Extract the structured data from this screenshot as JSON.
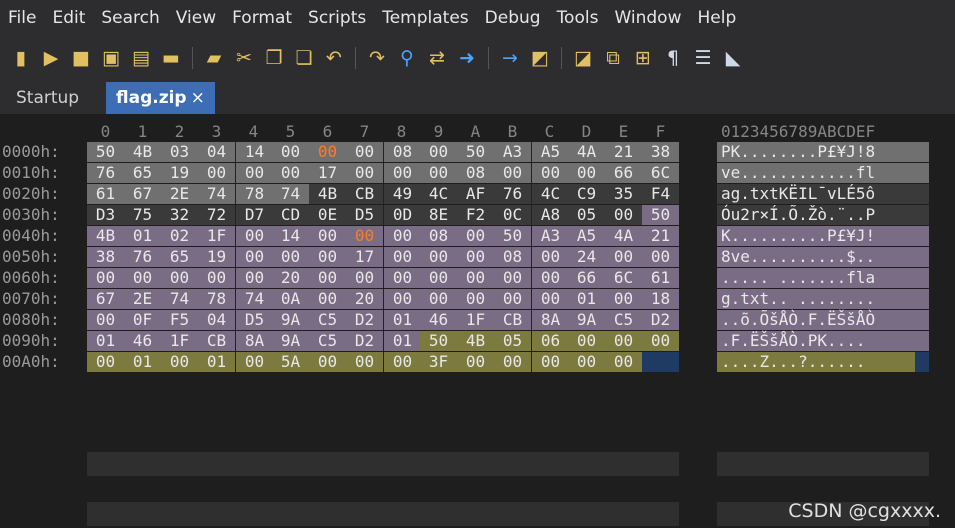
{
  "menu": [
    "File",
    "Edit",
    "Search",
    "View",
    "Format",
    "Scripts",
    "Templates",
    "Debug",
    "Tools",
    "Window",
    "Help"
  ],
  "toolbar_icons": [
    "new-file-icon",
    "open-icon",
    "save-icon",
    "save-as-icon",
    "save-all-icon",
    "open-folder-icon",
    "workspace-icon",
    "cut-icon",
    "copy-icon",
    "paste-icon",
    "undo-icon",
    "redo-icon",
    "find-icon",
    "replace-icon",
    "goto-icon",
    "next-icon",
    "bookmark-icon",
    "bookmark-next-icon",
    "hex-toggle-icon",
    "calculator-icon",
    "pilcrow-icon",
    "columns-icon",
    "highlight-icon"
  ],
  "tabs": [
    {
      "label": "Startup",
      "active": false
    },
    {
      "label": "flag.zip",
      "active": true,
      "close": "×"
    }
  ],
  "hex": {
    "column_header": [
      "0",
      "1",
      "2",
      "3",
      "4",
      "5",
      "6",
      "7",
      "8",
      "9",
      "A",
      "B",
      "C",
      "D",
      "E",
      "F"
    ],
    "ascii_header": "0123456789ABCDEF",
    "rows": [
      {
        "addr": "0000h:",
        "bytes": [
          "50",
          "4B",
          "03",
          "04",
          "14",
          "00",
          "00",
          "00",
          "08",
          "00",
          "50",
          "A3",
          "A5",
          "4A",
          "21",
          "38"
        ],
        "ascii": "PK........P£¥J!8"
      },
      {
        "addr": "0010h:",
        "bytes": [
          "76",
          "65",
          "19",
          "00",
          "00",
          "00",
          "17",
          "00",
          "00",
          "00",
          "08",
          "00",
          "00",
          "00",
          "66",
          "6C"
        ],
        "ascii": "ve............fl"
      },
      {
        "addr": "0020h:",
        "bytes": [
          "61",
          "67",
          "2E",
          "74",
          "78",
          "74",
          "4B",
          "CB",
          "49",
          "4C",
          "AF",
          "76",
          "4C",
          "C9",
          "35",
          "F4"
        ],
        "ascii": "ag.txtKËIL¯vLÉ5ô"
      },
      {
        "addr": "0030h:",
        "bytes": [
          "D3",
          "75",
          "32",
          "72",
          "D7",
          "CD",
          "0E",
          "D5",
          "0D",
          "8E",
          "F2",
          "0C",
          "A8",
          "05",
          "00",
          "50"
        ],
        "ascii": "Óu2r×Í.Õ.Žò.¨..P"
      },
      {
        "addr": "0040h:",
        "bytes": [
          "4B",
          "01",
          "02",
          "1F",
          "00",
          "14",
          "00",
          "00",
          "00",
          "08",
          "00",
          "50",
          "A3",
          "A5",
          "4A",
          "21"
        ],
        "ascii": "K..........P£¥J!"
      },
      {
        "addr": "0050h:",
        "bytes": [
          "38",
          "76",
          "65",
          "19",
          "00",
          "00",
          "00",
          "17",
          "00",
          "00",
          "00",
          "08",
          "00",
          "24",
          "00",
          "00"
        ],
        "ascii": "8ve..........$.."
      },
      {
        "addr": "0060h:",
        "bytes": [
          "00",
          "00",
          "00",
          "00",
          "00",
          "20",
          "00",
          "00",
          "00",
          "00",
          "00",
          "00",
          "00",
          "66",
          "6C",
          "61"
        ],
        "ascii": "..... .......fla"
      },
      {
        "addr": "0070h:",
        "bytes": [
          "67",
          "2E",
          "74",
          "78",
          "74",
          "0A",
          "00",
          "20",
          "00",
          "00",
          "00",
          "00",
          "00",
          "01",
          "00",
          "18"
        ],
        "ascii": "g.txt.. ........"
      },
      {
        "addr": "0080h:",
        "bytes": [
          "00",
          "0F",
          "F5",
          "04",
          "D5",
          "9A",
          "C5",
          "D2",
          "01",
          "46",
          "1F",
          "CB",
          "8A",
          "9A",
          "C5",
          "D2"
        ],
        "ascii": "..õ.ÕšÅÒ.F.ËŠšÅÒ"
      },
      {
        "addr": "0090h:",
        "bytes": [
          "01",
          "46",
          "1F",
          "CB",
          "8A",
          "9A",
          "C5",
          "D2",
          "01",
          "50",
          "4B",
          "05",
          "06",
          "00",
          "00",
          "00"
        ],
        "ascii": ".F.ËŠšÅÒ.PK...."
      },
      {
        "addr": "00A0h:",
        "bytes": [
          "00",
          "01",
          "00",
          "01",
          "00",
          "5A",
          "00",
          "00",
          "00",
          "3F",
          "00",
          "00",
          "00",
          "00",
          "00"
        ],
        "ascii": "....Z...?......"
      }
    ]
  },
  "colors": {
    "local_header": "#707070",
    "file_data": "#3a3a3a",
    "central_dir": "#7a6c85",
    "end_record": "#7c7a3e",
    "highlight_byte": "#ff7a29",
    "cursor": "#1f3a63"
  },
  "watermark": "CSDN @cgxxxx."
}
